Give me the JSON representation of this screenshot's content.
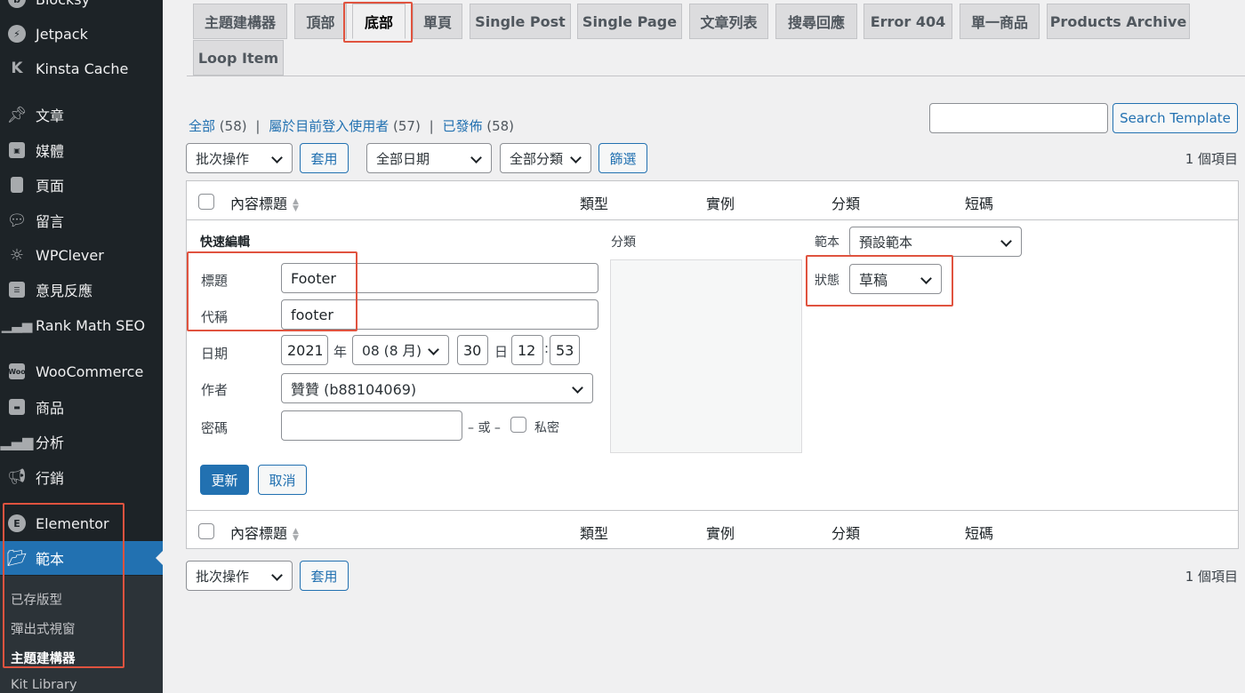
{
  "sidebar": {
    "items": [
      {
        "label": "Blocksy",
        "icon": "blocksy-icon"
      },
      {
        "label": "Jetpack",
        "icon": "jetpack-icon"
      },
      {
        "label": "Kinsta Cache",
        "icon": "kinsta-icon"
      },
      {
        "label": "文章",
        "icon": "pin-icon"
      },
      {
        "label": "媒體",
        "icon": "media-icon"
      },
      {
        "label": "頁面",
        "icon": "page-icon"
      },
      {
        "label": "留言",
        "icon": "comment-icon"
      },
      {
        "label": "WPClever",
        "icon": "wpclever-icon"
      },
      {
        "label": "意見反應",
        "icon": "feedback-icon"
      },
      {
        "label": "Rank Math SEO",
        "icon": "rankmath-icon"
      },
      {
        "label": "WooCommerce",
        "icon": "woocommerce-icon"
      },
      {
        "label": "商品",
        "icon": "products-icon"
      },
      {
        "label": "分析",
        "icon": "analytics-icon"
      },
      {
        "label": "行銷",
        "icon": "megaphone-icon"
      },
      {
        "label": "Elementor",
        "icon": "elementor-icon"
      },
      {
        "label": "範本",
        "icon": "folder-icon"
      }
    ],
    "submenu": [
      "已存版型",
      "彈出式視窗",
      "主題建構器",
      "Kit Library"
    ],
    "accent": "#2271b1"
  },
  "tabs": [
    "主題建構器",
    "頂部",
    "底部",
    "單頁",
    "Single Post",
    "Single Page",
    "文章列表",
    "搜尋回應",
    "Error 404",
    "單一商品",
    "Products Archive",
    "Loop Item"
  ],
  "filters": {
    "all": "全部",
    "all_count": "(58)",
    "mine": "屬於目前登入使用者",
    "mine_count": "(57)",
    "published": "已發佈",
    "published_count": "(58)",
    "sep": "|"
  },
  "search": {
    "value": "",
    "button": "Search Template"
  },
  "toolbar": {
    "bulk": "批次操作",
    "apply": "套用",
    "dates": "全部日期",
    "categories": "全部分類",
    "filter": "篩選",
    "count": "1 個項目"
  },
  "columns": {
    "title": "內容標題",
    "type": "類型",
    "instance": "實例",
    "category": "分類",
    "shortcode": "短碼"
  },
  "quick_edit": {
    "heading": "快速編輯",
    "title_label": "標題",
    "title_value": "Footer",
    "slug_label": "代稱",
    "slug_value": "footer",
    "date_label": "日期",
    "year": "2021",
    "year_unit": "年",
    "month": "08 (8 月)",
    "day": "30",
    "day_unit": "日",
    "hour": "12",
    "time_sep": ":",
    "minute": "53",
    "author_label": "作者",
    "author_value": "贊贊 (b88104069)",
    "password_label": "密碼",
    "password_value": "",
    "or_text": "– 或 –",
    "private_label": "私密",
    "category_label": "分類",
    "template_label": "範本",
    "template_value": "預設範本",
    "status_label": "狀態",
    "status_value": "草稿",
    "update": "更新",
    "cancel": "取消"
  },
  "colors": {
    "highlight": "#e0533f",
    "link": "#2271b1"
  }
}
